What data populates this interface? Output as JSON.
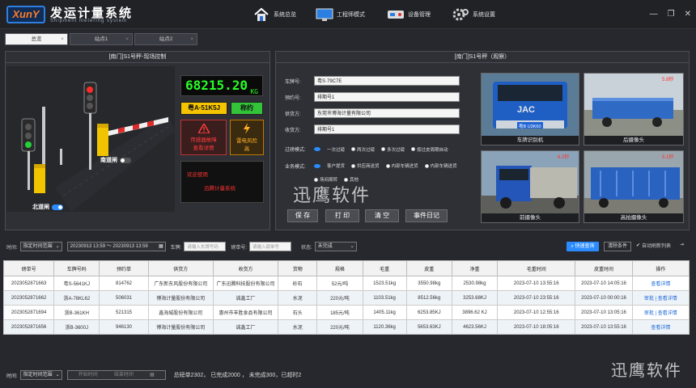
{
  "app": {
    "logo": "XunY",
    "title": "发运计量系统",
    "subtitle": "Shipment metering system"
  },
  "nav": [
    {
      "label": "系统总览",
      "icon": "home-icon"
    },
    {
      "label": "工程师模式",
      "icon": "monitor-icon"
    },
    {
      "label": "设备管理",
      "icon": "device-icon"
    },
    {
      "label": "系统设置",
      "icon": "gear-icon"
    }
  ],
  "window_controls": {
    "minimize": "—",
    "restore": "❐",
    "close": "✕"
  },
  "tabs": [
    {
      "label": "总览"
    },
    {
      "label": "站点1"
    },
    {
      "label": "站点2"
    }
  ],
  "site_control": {
    "title": "[南门]S1号秤-现场控制",
    "weight": "68215.20",
    "unit": "KG",
    "plate": "粤A·51K5J",
    "status": "称约",
    "alarm_text": "传感器故障查看详情",
    "alarm_lines": [
      "传感器故障",
      "查看详情"
    ],
    "lightning_lines": [
      "雷电风险",
      "高"
    ],
    "led_line1": "欢迎使用",
    "led_line2": "迅腾计量系统",
    "south_gate": "南道闸",
    "north_gate": "北道闸",
    "south_gate_on": false,
    "north_gate_on": true
  },
  "observe": {
    "title": "[南门]S1号秤（观察）",
    "fields": [
      {
        "label": "车牌号:",
        "value": "粤S·79C7E"
      },
      {
        "label": "预约号:",
        "value": "排期号1"
      },
      {
        "label": "供货方:",
        "value": "东莞市博海计量有限公司"
      },
      {
        "label": "收货方:",
        "value": "排期号1"
      }
    ],
    "weigh_mode_label": "过磅模式:",
    "weigh_modes": [
      "一次过磅",
      "两次过磅",
      "多次过磅",
      "按过皮周期自动"
    ],
    "weigh_mode_selected": 0,
    "business_mode_label": "业务模式:",
    "business_modes": [
      "客户提货",
      "供应商送货",
      "内部车辆进货",
      "内部车辆送货",
      "场间周转",
      "其他"
    ],
    "business_mode_selected": 0,
    "buttons": [
      "保 存",
      "打 印",
      "清 空",
      "事件日记"
    ],
    "cameras": [
      {
        "label": "车牌识别机",
        "plate": "粤B U3K60",
        "tag": ""
      },
      {
        "label": "后摄像头",
        "plate": "",
        "tag": "5.8秒"
      },
      {
        "label": "前摄像头",
        "plate": "",
        "tag": "6.2秒"
      },
      {
        "label": "高拍摄像头",
        "plate": "",
        "tag": "5.1秒"
      }
    ]
  },
  "watermark": "迅鹰软件",
  "filter": {
    "time_label": "时间:",
    "time_select": "指定时间范围",
    "time_range": "20230913  13:59  ～  20230913  13:59",
    "plate_label": "车牌:",
    "plate_placeholder": "请输入车牌号码",
    "ticket_label": "磅单号:",
    "ticket_placeholder": "请输入磅单号",
    "state_label": "状态:",
    "state_select": "未完成",
    "quick_query": "快速查询",
    "clear": "清除条件",
    "auto_refresh": "自动刷新列表"
  },
  "table": {
    "headers": [
      "磅单号",
      "车牌号码",
      "预约单",
      "供货方",
      "收货方",
      "货物",
      "规格",
      "毛重",
      "皮重",
      "净重",
      "毛重时间",
      "皮重时间",
      "操作"
    ],
    "rows": [
      {
        "cells": [
          "2023052871663",
          "粤S-5641KJ",
          "814762",
          "广东新东风股份有限公司",
          "广东迅腾科技股份有限公司",
          "砂石",
          "52元/吨",
          "1523.51kg",
          "3550.98kg",
          "2530.98kg",
          "2023-07-10  13:55:16",
          "2023-07-10 14:05:16"
        ],
        "op_review": "",
        "op_detail": "查看详情"
      },
      {
        "cells": [
          "2023052871662",
          "浙A-78KL62",
          "506031",
          "博海计量股份有限公司",
          "诚鑫工厂",
          "水泥",
          "220元/吨",
          "1103.51kg",
          "8512.56kg",
          "3253.68KJ",
          "2023-07-10  23:55:16",
          "2023-07-10 00:00:16"
        ],
        "op_review": "审批",
        "op_detail": "查看详情"
      },
      {
        "cells": [
          "2023052871694",
          "浙B-361KH",
          "521315",
          "鑫海城股份有限公司",
          "惠州市丰胜食品有限公司",
          "石头",
          "185元/吨",
          "1405.11kg",
          "6253.85KJ",
          "3896.62 KJ",
          "2023-07-10  12:55:16",
          "2023-07-10 13:05:16"
        ],
        "op_review": "审批",
        "op_detail": "查看详情"
      },
      {
        "cells": [
          "2023052871656",
          "浙B-3600J",
          "946130",
          "博海计量股份有限公司",
          "诚鑫工厂",
          "水泥",
          "220元/吨",
          "1120.36kg",
          "5653.63KJ",
          "4623.56KJ",
          "2023-07-10  18:05:16",
          "2023-07-10 13:55:16"
        ],
        "op_review": "",
        "op_detail": "查看详情"
      }
    ]
  },
  "footer": {
    "time_label": "时间:",
    "time_select": "指定时间范围",
    "start_placeholder": "开始时间",
    "end_placeholder": "结束时间",
    "summary": "总磅单2302， 已完成2000 ， 未完成300，已超时2"
  },
  "colors": {
    "accent": "#2b8cff",
    "lcd": "#27ff27",
    "alarm": "#ff3b3b",
    "plate": "#f5c400",
    "status": "#33c43a"
  }
}
